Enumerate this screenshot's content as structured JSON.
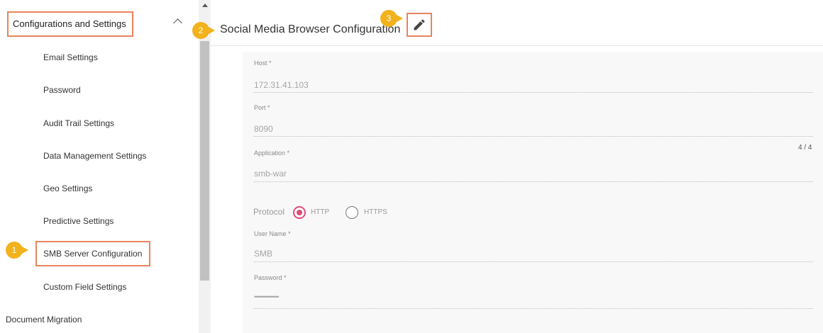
{
  "sidebar": {
    "section_title": "Configurations and Settings",
    "items": [
      {
        "label": "Email Settings"
      },
      {
        "label": "Password"
      },
      {
        "label": "Audit Trail Settings"
      },
      {
        "label": "Data Management Settings"
      },
      {
        "label": "Geo Settings"
      },
      {
        "label": "Predictive Settings"
      },
      {
        "label": "SMB Server Configuration"
      },
      {
        "label": "Custom Field Settings"
      }
    ],
    "bottom_item": "Document Migration"
  },
  "badges": {
    "b1": "1",
    "b2": "2",
    "b3": "3"
  },
  "header": {
    "title": "Social Media Browser Configuration"
  },
  "form": {
    "host_label": "Host *",
    "host_value": "172.31.41.103",
    "port_label": "Port *",
    "port_value": "8090",
    "app_label": "Application *",
    "app_value": "smb-war",
    "app_counter": "4 / 4",
    "protocol_label": "Protocol",
    "protocol_options": [
      "HTTP",
      "HTTPS"
    ],
    "protocol_selected": "HTTP",
    "user_label": "User Name *",
    "user_value": "SMB",
    "password_label": "Password *",
    "password_value": "••••••••••••••••"
  },
  "colors": {
    "highlight": "#e8845c",
    "badge": "#f2b21b",
    "radio_active": "#e04b77"
  }
}
